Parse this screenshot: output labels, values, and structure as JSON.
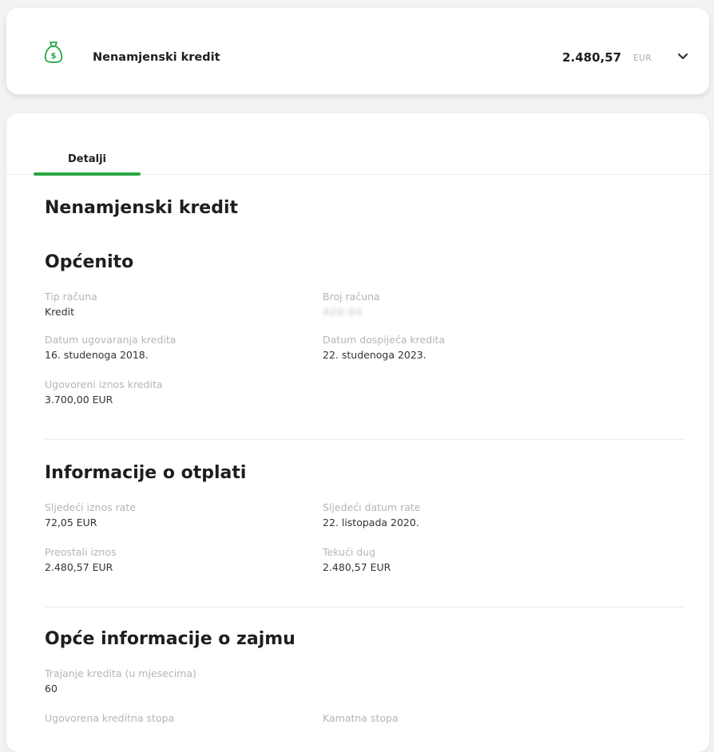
{
  "top_card": {
    "title": "Nenamjenski kredit",
    "amount": "2.480,57",
    "currency": "EUR",
    "icon": "money-bag-icon",
    "accent": "#28a745"
  },
  "tabs": [
    {
      "label": "Detalji",
      "active": true
    }
  ],
  "details": {
    "title": "Nenamjenski kredit",
    "general": {
      "heading": "Općenito",
      "account_type_label": "Tip računa",
      "account_type_value": "Kredit",
      "account_number_label": "Broj računa",
      "account_number_value": "420-04",
      "contract_date_label": "Datum ugovaranja kredita",
      "contract_date_value": "16. studenoga 2018.",
      "maturity_date_label": "Datum dospijeća kredita",
      "maturity_date_value": "22. studenoga 2023.",
      "contracted_amount_label": "Ugovoreni iznos kredita",
      "contracted_amount_value": "3.700,00 EUR"
    },
    "repayment": {
      "heading": "Informacije o otplati",
      "next_installment_amount_label": "Sljedeći iznos rate",
      "next_installment_amount_value": "72,05 EUR",
      "next_installment_date_label": "Sljedeći datum rate",
      "next_installment_date_value": "22. listopada 2020.",
      "remaining_amount_label": "Preostali iznos",
      "remaining_amount_value": "2.480,57 EUR",
      "current_debt_label": "Tekući dug",
      "current_debt_value": "2.480,57 EUR"
    },
    "loan_info": {
      "heading": "Opće informacije o zajmu",
      "duration_label": "Trajanje kredita (u mjesecima)",
      "duration_value": "60",
      "contracted_rate_label": "Ugovorena kreditna stopa",
      "interest_rate_label": "Kamatna stopa"
    }
  }
}
